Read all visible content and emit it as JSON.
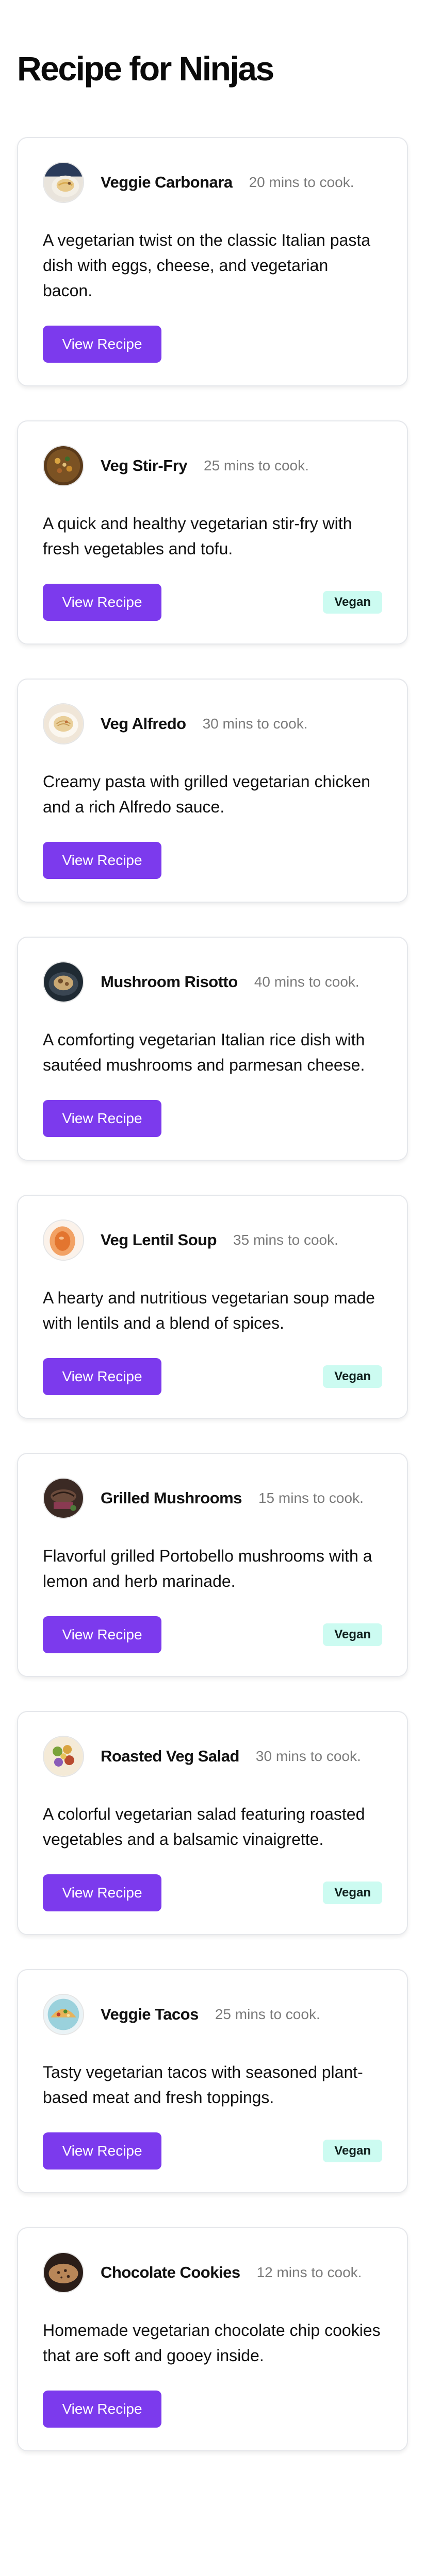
{
  "page": {
    "title": "Recipe for Ninjas"
  },
  "recipes": [
    {
      "name": "Veggie Carbonara",
      "cook_time": "20 mins to cook.",
      "description": "A vegetarian twist on the classic Italian pasta dish with eggs, cheese, and vegetarian bacon.",
      "button_label": "View Recipe",
      "badge": "",
      "thumbnail": "carbonara-photo"
    },
    {
      "name": "Veg Stir-Fry",
      "cook_time": "25 mins to cook.",
      "description": "A quick and healthy vegetarian stir-fry with fresh vegetables and tofu.",
      "button_label": "View Recipe",
      "badge": "Vegan",
      "thumbnail": "stir-fry-photo"
    },
    {
      "name": "Veg Alfredo",
      "cook_time": "30 mins to cook.",
      "description": "Creamy pasta with grilled vegetarian chicken and a rich Alfredo sauce.",
      "button_label": "View Recipe",
      "badge": "",
      "thumbnail": "alfredo-photo"
    },
    {
      "name": "Mushroom Risotto",
      "cook_time": "40 mins to cook.",
      "description": "A comforting vegetarian Italian rice dish with sautéed mushrooms and parmesan cheese.",
      "button_label": "View Recipe",
      "badge": "",
      "thumbnail": "risotto-photo"
    },
    {
      "name": "Veg Lentil Soup",
      "cook_time": "35 mins to cook.",
      "description": "A hearty and nutritious vegetarian soup made with lentils and a blend of spices.",
      "button_label": "View Recipe",
      "badge": "Vegan",
      "thumbnail": "lentil-soup-photo"
    },
    {
      "name": "Grilled Mushrooms",
      "cook_time": "15 mins to cook.",
      "description": "Flavorful grilled Portobello mushrooms with a lemon and herb marinade.",
      "button_label": "View Recipe",
      "badge": "Vegan",
      "thumbnail": "grilled-mushrooms-photo"
    },
    {
      "name": "Roasted Veg Salad",
      "cook_time": "30 mins to cook.",
      "description": "A colorful vegetarian salad featuring roasted vegetables and a balsamic vinaigrette.",
      "button_label": "View Recipe",
      "badge": "Vegan",
      "thumbnail": "salad-photo"
    },
    {
      "name": "Veggie Tacos",
      "cook_time": "25 mins to cook.",
      "description": "Tasty vegetarian tacos with seasoned plant-based meat and fresh toppings.",
      "button_label": "View Recipe",
      "badge": "Vegan",
      "thumbnail": "tacos-photo"
    },
    {
      "name": "Chocolate Cookies",
      "cook_time": "12 mins to cook.",
      "description": "Homemade vegetarian chocolate chip cookies that are soft and gooey inside.",
      "button_label": "View Recipe",
      "badge": "",
      "thumbnail": "cookies-photo"
    }
  ],
  "colors": {
    "accent": "#7c3aed",
    "badge_bg": "#ccfbf1",
    "border": "#e5e7eb",
    "muted_text": "#7b7b7b"
  }
}
